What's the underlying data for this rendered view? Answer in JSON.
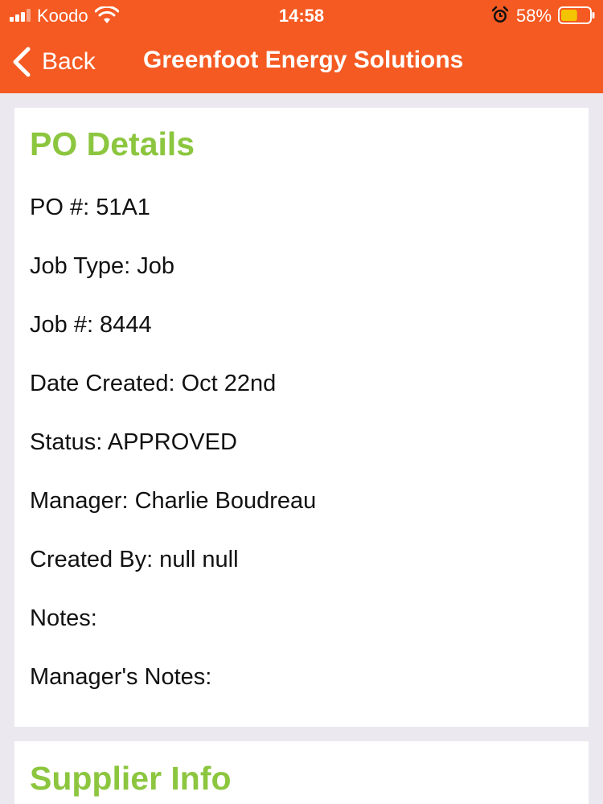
{
  "status_bar": {
    "carrier": "Koodo",
    "time": "14:58",
    "battery_percent": "58%",
    "battery_level": 0.58,
    "icons": [
      "signal-icon",
      "wifi-icon",
      "alarm-icon",
      "battery-icon"
    ]
  },
  "nav": {
    "back_label": "Back",
    "title": "Greenfoot Energy Solutions",
    "back_icon": "chevron-left-icon"
  },
  "po_details": {
    "title": "PO Details",
    "rows": [
      "PO #: 51A1",
      "Job Type: Job",
      "Job #: 8444",
      "Date Created: Oct 22nd",
      "Status: APPROVED",
      "Manager: Charlie Boudreau",
      "Created By: null null",
      "Notes:",
      "Manager's Notes:"
    ]
  },
  "supplier_info": {
    "title": "Supplier Info"
  },
  "colors": {
    "header_bg": "#f55a22",
    "section_title": "#8cc63f",
    "page_bg": "#ebe9ef",
    "battery_fill": "#f5c400"
  }
}
